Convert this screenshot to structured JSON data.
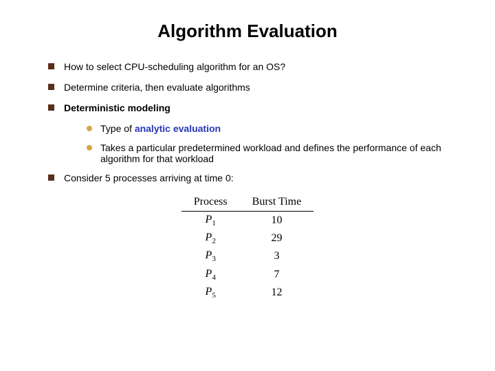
{
  "title": "Algorithm Evaluation",
  "bullets": [
    {
      "text": "How to select CPU-scheduling algorithm for an OS?"
    },
    {
      "text": "Determine criteria, then evaluate algorithms"
    },
    {
      "prefix": "Deterministic modeling",
      "sub": [
        {
          "prefix": "Type of ",
          "emph": "analytic evaluation"
        },
        {
          "text": "Takes a particular predetermined workload and defines the performance of each algorithm  for that workload"
        }
      ]
    },
    {
      "text": "Consider 5 processes arriving at time 0:"
    }
  ],
  "table": {
    "headers": [
      "Process",
      "Burst Time"
    ],
    "rows": [
      {
        "p": "P",
        "sub": "1",
        "burst": "10"
      },
      {
        "p": "P",
        "sub": "2",
        "burst": "29"
      },
      {
        "p": "P",
        "sub": "3",
        "burst": "3"
      },
      {
        "p": "P",
        "sub": "4",
        "burst": "7"
      },
      {
        "p": "P",
        "sub": "5",
        "burst": "12"
      }
    ]
  }
}
